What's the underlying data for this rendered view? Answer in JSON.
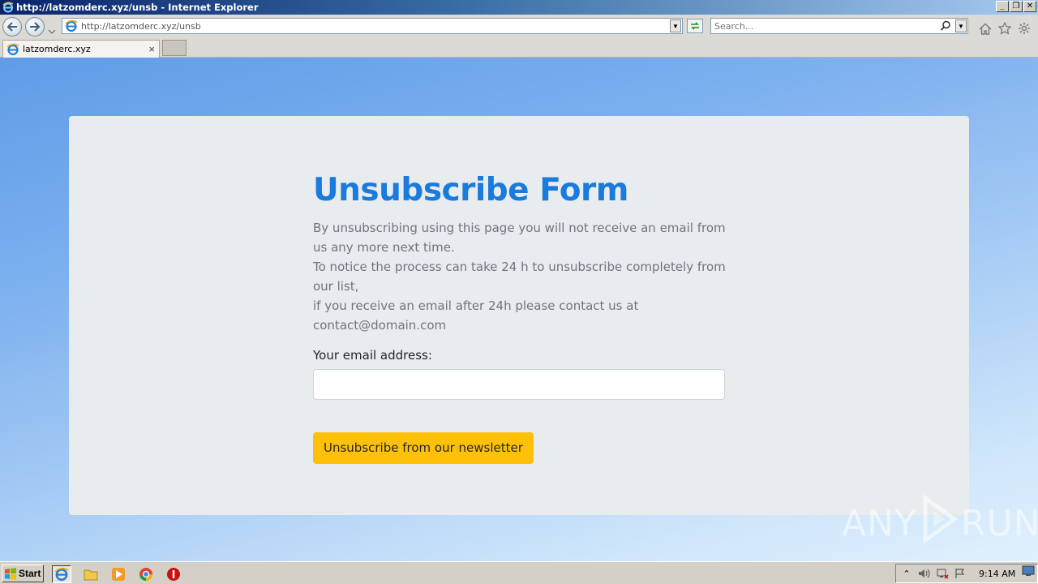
{
  "window": {
    "title": "http://latzomderc.xyz/unsb - Internet Explorer",
    "controls": {
      "minimize": "_",
      "restore": "❐",
      "close": "✕"
    }
  },
  "navbar": {
    "address": "http://latzomderc.xyz/unsb",
    "search_placeholder": "Search..."
  },
  "tabs": [
    {
      "label": "latzomderc.xyz",
      "close": "×"
    }
  ],
  "page": {
    "title": "Unsubscribe Form",
    "description_lines": [
      "By unsubscribing using this page you will not receive an email from us any more next time.",
      "To notice the process can take 24 h to unsubscribe completely from our list,",
      "if you receive an email after 24h please contact us at contact@domain.com"
    ],
    "email_label": "Your email address:",
    "email_value": "",
    "submit_label": "Unsubscribe from our newsletter",
    "accent_color": "#1a7bdc",
    "button_color": "#ffc107"
  },
  "watermark": {
    "left": "ANY",
    "right": "RUN"
  },
  "taskbar": {
    "start_label": "Start",
    "icons": [
      "ie-icon",
      "folder-icon",
      "media-player-icon",
      "chrome-icon",
      "stop-icon"
    ],
    "clock": "9:14 AM"
  }
}
